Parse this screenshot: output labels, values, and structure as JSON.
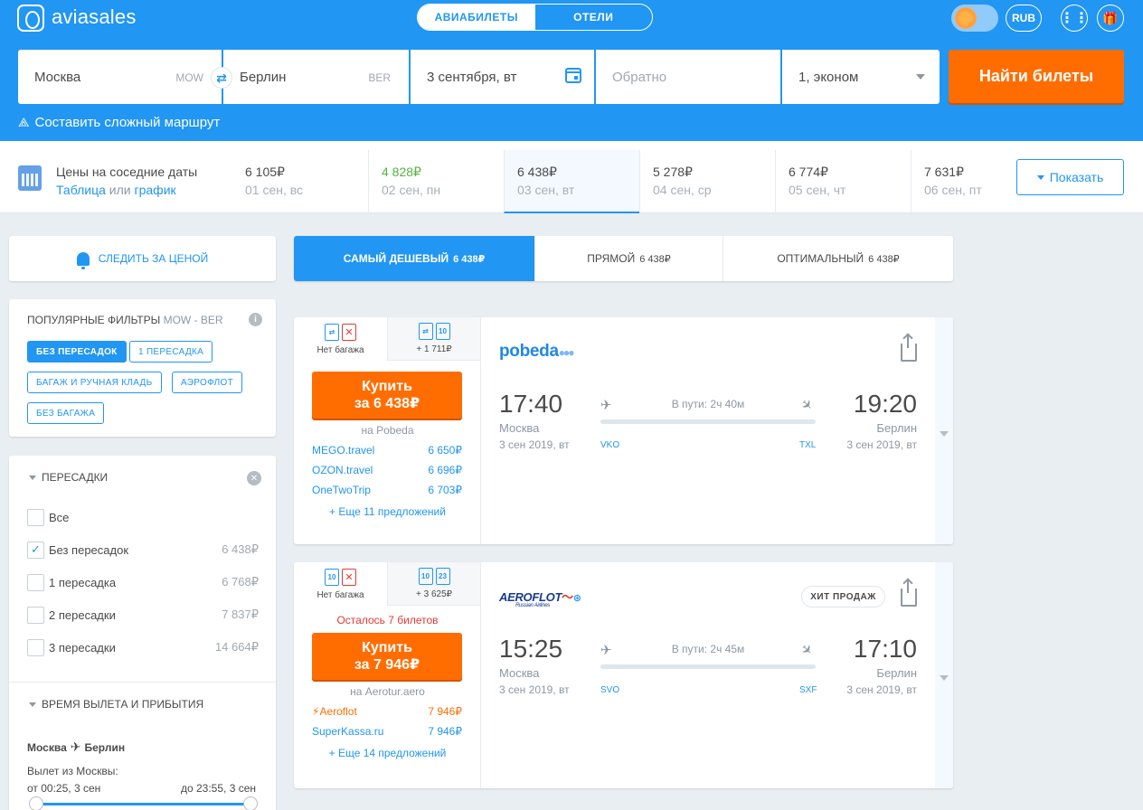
{
  "header": {
    "logo_text": "aviasales",
    "tabs": [
      {
        "label": "АВИАБИЛЕТЫ",
        "active": true
      },
      {
        "label": "ОТЕЛИ",
        "active": false
      }
    ],
    "currency": "RUB",
    "apps_icon": "grid-icon",
    "gift_icon": "gift-icon",
    "theme_icon": "sun-icon"
  },
  "search": {
    "origin": "Москва",
    "origin_code": "MOW",
    "destination": "Берлин",
    "destination_code": "BER",
    "depart_date": "3 сентября, вт",
    "return_placeholder": "Обратно",
    "passengers": "1, эконом",
    "submit_label": "Найти билеты",
    "complex_route_label": "Составить сложный маршрут"
  },
  "nearby_dates": {
    "title": "Цены на соседние даты",
    "sub_table": "Таблица",
    "sub_or": " или ",
    "sub_chart": "график",
    "show_label": "Показать",
    "cells": [
      {
        "price": "6 105₽",
        "day": "01 сен, вс",
        "style": ""
      },
      {
        "price": "4 828₽",
        "day": "02 сен, пн",
        "style": "green"
      },
      {
        "price": "6 438₽",
        "day": "03 сен, вт",
        "style": "active"
      },
      {
        "price": "5 278₽",
        "day": "04 сен, ср",
        "style": ""
      },
      {
        "price": "6 774₽",
        "day": "05 сен, чт",
        "style": ""
      },
      {
        "price": "7 631₽",
        "day": "06 сен, пт",
        "style": ""
      }
    ]
  },
  "sidebar": {
    "watch_label": "СЛЕДИТЬ ЗА ЦЕНОЙ",
    "popular": {
      "title": "ПОПУЛЯРНЫЕ ФИЛЬТРЫ",
      "route": "MOW - BER",
      "chips": [
        {
          "label": "БЕЗ ПЕРЕСАДОК",
          "active": true
        },
        {
          "label": "1 ПЕРЕСАДКА",
          "active": false
        },
        {
          "label": "БАГАЖ И РУЧНАЯ КЛАДЬ",
          "active": false
        },
        {
          "label": "АЭРОФЛОТ",
          "active": false
        },
        {
          "label": "БЕЗ БАГАЖА",
          "active": false
        }
      ]
    },
    "stops": {
      "title": "ПЕРЕСАДКИ",
      "options": [
        {
          "label": "Все",
          "price": "",
          "checked": false
        },
        {
          "label": "Без пересадок",
          "price": "6 438₽",
          "checked": true
        },
        {
          "label": "1 пересадка",
          "price": "6 768₽",
          "checked": false
        },
        {
          "label": "2 пересадки",
          "price": "7 837₽",
          "checked": false
        },
        {
          "label": "3 пересадки",
          "price": "14 664₽",
          "checked": false
        }
      ]
    },
    "times": {
      "title": "ВРЕМЯ ВЫЛЕТА И ПРИБЫТИЯ",
      "route_from": "Москва",
      "route_to": "Берлин",
      "departure_label": "Вылет из Москвы:",
      "from": "от 00:25, 3 сен",
      "to": "до 23:55, 3 сен"
    }
  },
  "sort_tabs": [
    {
      "label": "САМЫЙ ДЕШЕВЫЙ",
      "price": "6 438₽",
      "active": true
    },
    {
      "label": "ПРЯМОЙ",
      "price": "6 438₽",
      "active": false
    },
    {
      "label": "ОПТИМАЛЬНЫЙ",
      "price": "6 438₽",
      "active": false
    }
  ],
  "tickets": [
    {
      "bag_left_label": "Нет багажа",
      "bag_right_label": "+ 1 711₽",
      "bag_right_kg": "10",
      "buy_line1": "Купить",
      "buy_line2": "за 6 438₽",
      "agent": "на Pobeda",
      "offers": [
        {
          "name": "MEGO.travel",
          "price": "6 650₽"
        },
        {
          "name": "OZON.travel",
          "price": "6 696₽"
        },
        {
          "name": "OneTwoTrip",
          "price": "6 703₽"
        }
      ],
      "more": "+ Еще 11 предложений",
      "airline": "pobeda",
      "dep_time": "17:40",
      "dep_city": "Москва",
      "dep_date": "3 сен 2019, вт",
      "dep_iata": "VKO",
      "arr_time": "19:20",
      "arr_city": "Берлин",
      "arr_date": "3 сен 2019, вт",
      "arr_iata": "TXL",
      "duration": "В пути: 2ч 40м"
    },
    {
      "bag_left_label": "Нет багажа",
      "bag_left_kg": "10",
      "bag_right_label": "+ 3 625₽",
      "bag_right_kg": "10",
      "bag_right_kg2": "23",
      "tickets_left": "Осталось 7 билетов",
      "buy_line1": "Купить",
      "buy_line2": "за 7 946₽",
      "agent": "на Aerotur.aero",
      "offers": [
        {
          "name": "Aeroflot",
          "price": "7 946₽"
        },
        {
          "name": "SuperKassa.ru",
          "price": "7 946₽"
        }
      ],
      "more": "+ Еще 14 предложений",
      "airline": "AEROFLOT",
      "airline_sub": "Russian Airlines",
      "badge": "ХИТ ПРОДАЖ",
      "dep_time": "15:25",
      "dep_city": "Москва",
      "dep_date": "3 сен 2019, вт",
      "dep_iata": "SVO",
      "arr_time": "17:10",
      "arr_city": "Берлин",
      "arr_date": "3 сен 2019, вт",
      "arr_iata": "SXF",
      "duration": "В пути: 2ч 45м"
    }
  ]
}
